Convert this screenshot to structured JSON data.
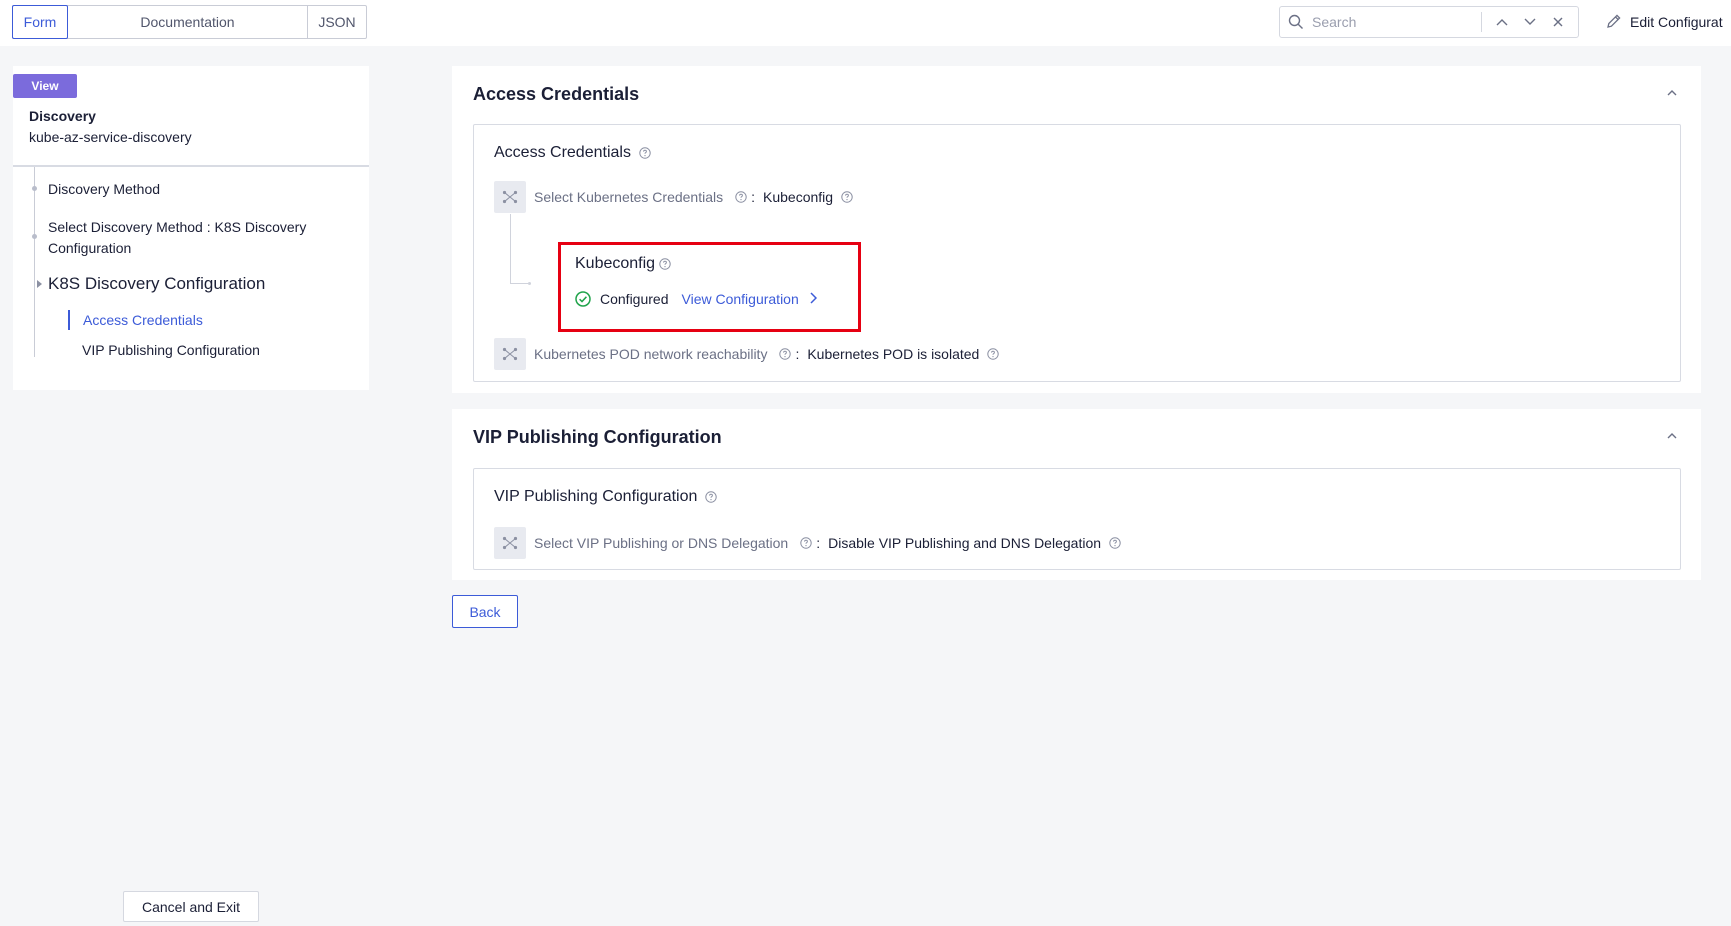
{
  "toolbar": {
    "tabs": [
      {
        "label": "Form",
        "active": true
      },
      {
        "label": "Documentation",
        "active": false
      },
      {
        "label": "JSON",
        "active": false
      }
    ],
    "search": {
      "placeholder": "Search"
    },
    "edit_label": "Edit Configurat"
  },
  "sidebar": {
    "badge": "View",
    "title": "Discovery",
    "name": "kube-az-service-discovery",
    "items": [
      {
        "label": "Discovery Method"
      },
      {
        "label": "Select Discovery Method : K8S Discovery Configuration"
      },
      {
        "label": "K8S Discovery Configuration"
      }
    ],
    "sub_items": [
      {
        "label": "Access Credentials",
        "active": true
      },
      {
        "label": "VIP Publishing Configuration",
        "active": false
      }
    ],
    "cancel_label": "Cancel and Exit"
  },
  "sections": {
    "access": {
      "title": "Access Credentials",
      "inner_title": "Access Credentials",
      "field1": {
        "label": "Select Kubernetes Credentials",
        "sep": ":",
        "value": "Kubeconfig"
      },
      "kube": {
        "title": "Kubeconfig",
        "status": "Configured",
        "link": "View Configuration"
      },
      "field2": {
        "label": "Kubernetes POD network reachability",
        "sep": ":",
        "value": "Kubernetes POD is isolated"
      }
    },
    "vip": {
      "title": "VIP Publishing Configuration",
      "inner_title": "VIP Publishing Configuration",
      "field1": {
        "label": "Select VIP Publishing or DNS Delegation",
        "sep": ":",
        "value": "Disable VIP Publishing and DNS Delegation"
      }
    }
  },
  "back_label": "Back",
  "colors": {
    "accent": "#3c5bd8",
    "badge": "#7b6bdc",
    "highlight": "#e60012",
    "success": "#1fa34a"
  }
}
